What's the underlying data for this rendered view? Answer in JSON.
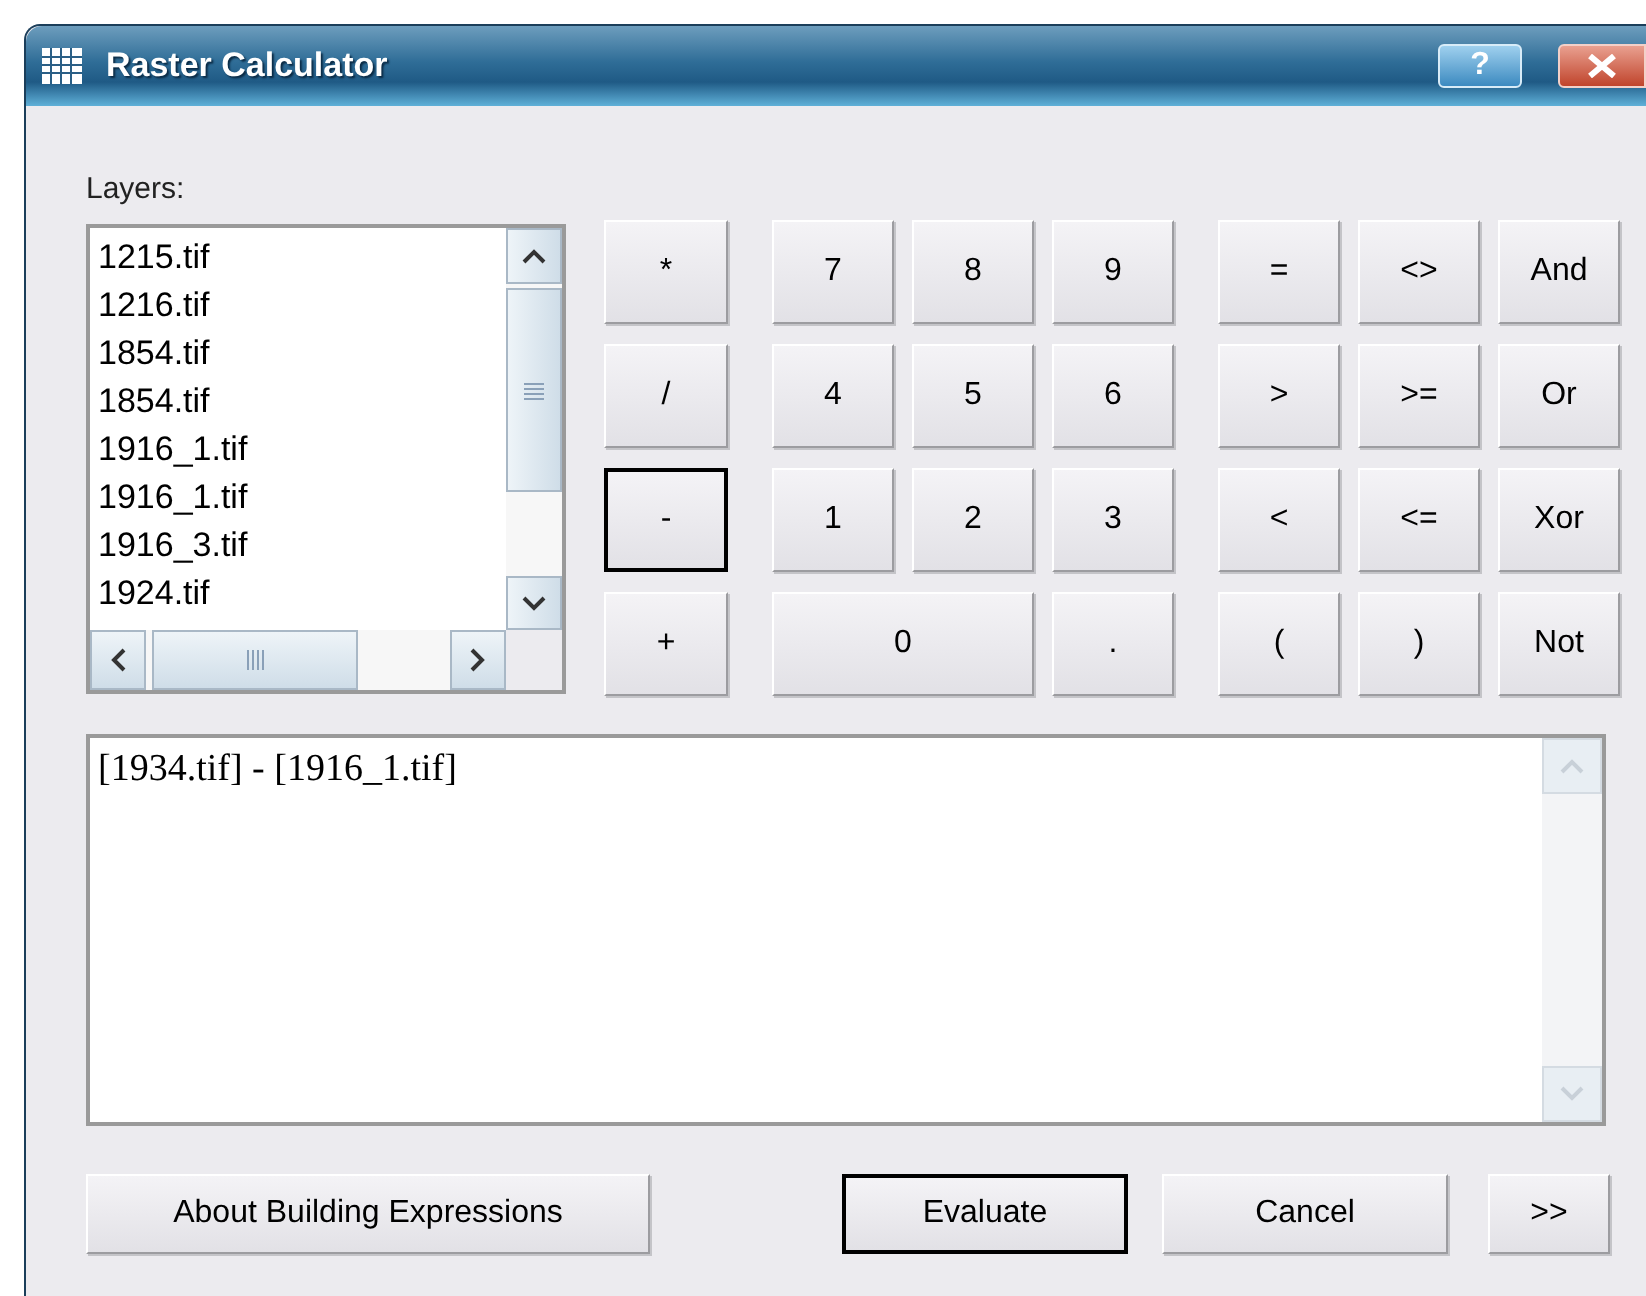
{
  "window": {
    "title": "Raster Calculator",
    "help_button": "?"
  },
  "layers": {
    "label": "Layers:",
    "items": [
      "1215.tif",
      "1216.tif",
      "1854.tif",
      "1854.tif",
      "1916_1.tif",
      "1916_1.tif",
      "1916_3.tif",
      "1924.tif"
    ]
  },
  "keypad": {
    "operators": [
      {
        "label": "*",
        "focused": false
      },
      {
        "label": "/",
        "focused": false
      },
      {
        "label": "-",
        "focused": true
      },
      {
        "label": "+",
        "focused": false
      }
    ],
    "digits": [
      {
        "label": "7"
      },
      {
        "label": "8"
      },
      {
        "label": "9"
      },
      {
        "label": "4"
      },
      {
        "label": "5"
      },
      {
        "label": "6"
      },
      {
        "label": "1"
      },
      {
        "label": "2"
      },
      {
        "label": "3"
      },
      {
        "label": "0"
      },
      {
        "label": "."
      }
    ],
    "logic": [
      {
        "label": "="
      },
      {
        "label": "<>"
      },
      {
        "label": "And"
      },
      {
        "label": ">"
      },
      {
        "label": ">="
      },
      {
        "label": "Or"
      },
      {
        "label": "<"
      },
      {
        "label": "<="
      },
      {
        "label": "Xor"
      },
      {
        "label": "("
      },
      {
        "label": ")"
      },
      {
        "label": "Not"
      }
    ]
  },
  "expression": "[1934.tif] - [1916_1.tif]",
  "buttons": [
    {
      "label": "About Building Expressions",
      "default": false
    },
    {
      "label": "Evaluate",
      "default": true
    },
    {
      "label": "Cancel",
      "default": false
    },
    {
      "label": ">>",
      "default": false
    }
  ]
}
